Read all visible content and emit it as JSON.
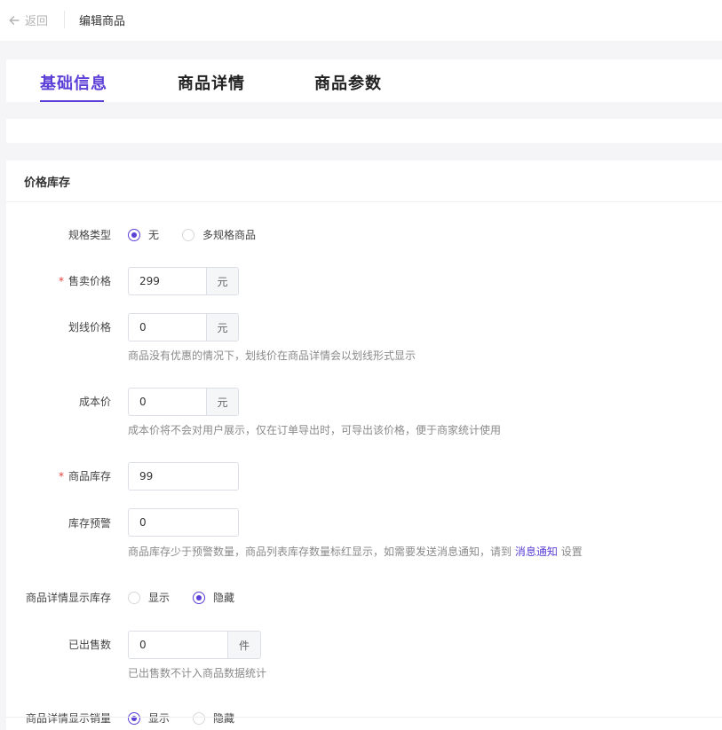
{
  "header": {
    "back_label": "返回",
    "title": "编辑商品"
  },
  "tabs": [
    {
      "label": "基础信息",
      "active": true
    },
    {
      "label": "商品详情",
      "active": false
    },
    {
      "label": "商品参数",
      "active": false
    }
  ],
  "section": {
    "title": "价格库存"
  },
  "form": {
    "spec_type": {
      "label": "规格类型",
      "options": [
        {
          "label": "无",
          "selected": true
        },
        {
          "label": "多规格商品",
          "selected": false
        }
      ]
    },
    "sale_price": {
      "label": "售卖价格",
      "required_mark": "*",
      "value": "299",
      "suffix": "元"
    },
    "line_price": {
      "label": "划线价格",
      "value": "0",
      "suffix": "元",
      "hint": "商品没有优惠的情况下，划线价在商品详情会以划线形式显示"
    },
    "cost_price": {
      "label": "成本价",
      "value": "0",
      "suffix": "元",
      "hint": "成本价将不会对用户展示，仅在订单导出时，可导出该价格，便于商家统计使用"
    },
    "stock": {
      "label": "商品库存",
      "required_mark": "*",
      "value": "99"
    },
    "stock_warning": {
      "label": "库存预警",
      "value": "0",
      "hint_before": "商品库存少于预警数量，商品列表库存数量标红显示，如需要发送消息通知，请到",
      "hint_link": "消息通知",
      "hint_after": "设置"
    },
    "show_stock": {
      "label": "商品详情显示库存",
      "options": [
        {
          "label": "显示",
          "selected": false
        },
        {
          "label": "隐藏",
          "selected": true
        }
      ]
    },
    "sold_count": {
      "label": "已出售数",
      "value": "0",
      "suffix": "件",
      "hint": "已出售数不计入商品数据统计"
    },
    "show_sales": {
      "label": "商品详情显示销量",
      "options": [
        {
          "label": "显示",
          "selected": true
        },
        {
          "label": "隐藏",
          "selected": false
        }
      ]
    }
  },
  "colors": {
    "accent": "#5b3fd6",
    "required": "#e0413a",
    "page_bg": "#f5f5f7"
  }
}
